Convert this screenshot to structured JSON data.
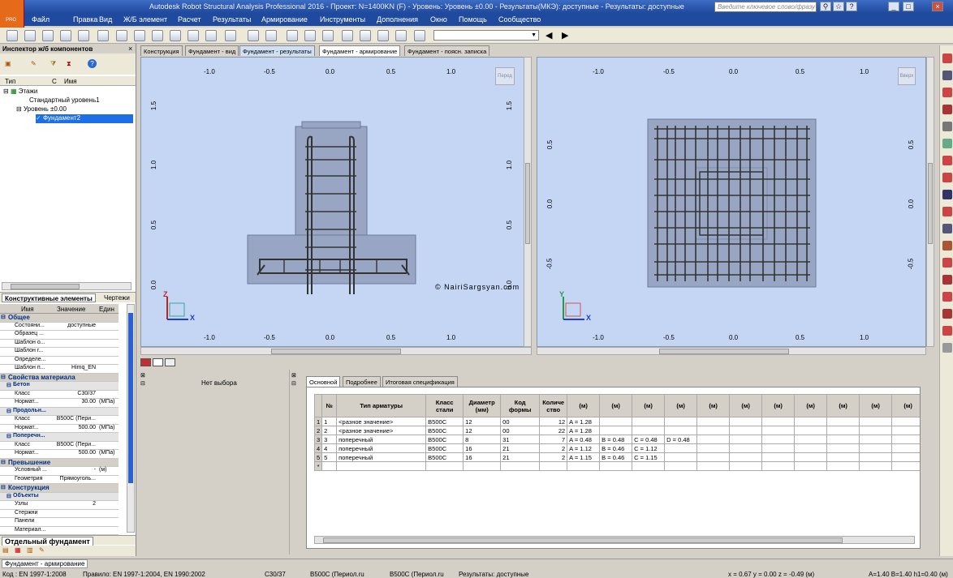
{
  "window": {
    "title": "Autodesk Robot Structural Analysis Professional 2016 - Проект: N=1400KN (F) - Уровень: Уровень ±0.00 - Результаты(МКЭ): доступные - Результаты: доступные",
    "search_placeholder": "Введите ключевое слово/фразу",
    "logo": "PRO"
  },
  "menu": [
    "Файл",
    "Правка",
    "Вид",
    "Ж/Б элемент",
    "Расчет",
    "Результаты",
    "Армирование",
    "Инструменты",
    "Дополнения",
    "Окно",
    "Помощь",
    "Сообщество"
  ],
  "inspector": {
    "title": "Инспектор ж/б компонентов",
    "col_type": "Тип",
    "col_c": "С",
    "col_name": "Имя",
    "tree": [
      "Этажи",
      "Стандартный уровень1",
      "Уровень ±0.00",
      "Фундамент2"
    ],
    "tab1": "Конструктивные элементы",
    "tab2": "Чертежи"
  },
  "props": {
    "col_name": "Имя",
    "col_value": "Значение",
    "col_unit": "Един",
    "rows": [
      {
        "type": "g",
        "n": "Общее"
      },
      {
        "n": "Состояни...",
        "v": "доступные",
        "u": ""
      },
      {
        "n": "Образец ...",
        "v": "",
        "u": ""
      },
      {
        "n": "Шаблон о...",
        "v": "",
        "u": ""
      },
      {
        "n": "Шаблон г...",
        "v": "",
        "u": ""
      },
      {
        "n": "Определе...",
        "v": "",
        "u": ""
      },
      {
        "n": "Шаблон п...",
        "v": "Himq_EN",
        "u": ""
      },
      {
        "type": "g",
        "n": "Свойства материала"
      },
      {
        "type": "s",
        "n": "Бетон"
      },
      {
        "n": "Класс",
        "v": "C30/37",
        "u": ""
      },
      {
        "n": "Нормат...",
        "v": "30.00",
        "u": "(МПа)"
      },
      {
        "type": "s",
        "n": "Продольн..."
      },
      {
        "n": "Класс",
        "v": "B500C (Пери...",
        "u": ""
      },
      {
        "n": "Нормат...",
        "v": "500.00",
        "u": "(МПа)"
      },
      {
        "type": "s",
        "n": "Поперечн..."
      },
      {
        "n": "Класс",
        "v": "B500C (Пери...",
        "u": ""
      },
      {
        "n": "Нормат...",
        "v": "500.00",
        "u": "(МПа)"
      },
      {
        "type": "g",
        "n": "Превышение"
      },
      {
        "n": "Условный ...",
        "v": "-",
        "u": "(м)"
      },
      {
        "n": "Геометрия",
        "v": "Прямоуголь...",
        "u": ""
      },
      {
        "type": "g",
        "n": "Конструкция"
      },
      {
        "type": "s",
        "n": "Объекты"
      },
      {
        "n": "Узлы",
        "v": "2",
        "u": ""
      },
      {
        "n": "Стержни",
        "v": "",
        "u": ""
      },
      {
        "n": "Панели",
        "v": "",
        "u": ""
      },
      {
        "n": "Материал...",
        "v": "",
        "u": ""
      }
    ],
    "footer_tab": "Отдельный фундамент"
  },
  "view_tabs": [
    "Конструкция",
    "Фундамент - вид",
    "Фундамент - результаты",
    "Фундамент - армирование",
    "Фундамент - поясн. записка"
  ],
  "views": {
    "left_btn": "Перед",
    "right_btn": "Вверх",
    "xticks": [
      "-1.0",
      "-0.5",
      "0.0",
      "0.5",
      "1.0"
    ],
    "left_yticks": [
      "1.5",
      "1.0",
      "0.5",
      "0.0"
    ],
    "right_yticks": [
      "0.5",
      "0.0",
      "-0.5"
    ],
    "watermark": "© NairiSargsyan.com",
    "axis_x": "X",
    "axis_z": "Z",
    "axis_y": "Y"
  },
  "bottom": {
    "no_selection": "Нет выбора",
    "tabs": [
      "Основной",
      "Подробнее",
      "Итоговая спецификация"
    ],
    "headers": [
      "№",
      "Тип арматуры",
      "Класс стали",
      "Диаметр (мм)",
      "Код формы",
      "Количе ство",
      "(м)",
      "(м)",
      "(м)",
      "(м)",
      "(м)",
      "(м)",
      "(м)",
      "(м)",
      "(м)",
      "(м)",
      "(м)"
    ],
    "rows": [
      [
        "1",
        "1",
        "<разное значение>",
        "B500C",
        "12",
        "00",
        "12",
        "A = 1.28",
        "",
        "",
        ""
      ],
      [
        "2",
        "2",
        "<разное значение>",
        "B500C",
        "12",
        "00",
        "22",
        "A = 1.28",
        "",
        "",
        ""
      ],
      [
        "3",
        "3",
        "поперечный",
        "B500C",
        "8",
        "31",
        "7",
        "A = 0.48",
        "B = 0.48",
        "C = 0.48",
        "D = 0.48"
      ],
      [
        "4",
        "4",
        "поперечный",
        "B500C",
        "16",
        "21",
        "2",
        "A = 1.12",
        "B = 0.46",
        "C = 1.12",
        ""
      ],
      [
        "5",
        "5",
        "поперечный",
        "B500C",
        "16",
        "21",
        "2",
        "A = 1.15",
        "B = 0.46",
        "C = 1.15",
        ""
      ],
      [
        "*",
        "",
        "",
        "",
        "",
        "",
        "",
        "",
        "",
        "",
        ""
      ]
    ]
  },
  "status": {
    "bottom_tab": "Фундамент - армирование",
    "code": "Код : EN 1997-1:2008",
    "rules": "Правило: EN 1997-1:2004, EN 1990:2002",
    "concrete": "C30/37",
    "steel1": "B500C (Периол.ru",
    "steel2": "B500C (Периол.ru",
    "results": "Результаты: доступные",
    "coords": "x = 0.67  y = 0.00  z = -0.49   (м)",
    "dims": "A=1.40 B=1.40 h1=0.40 (м)"
  },
  "colors": {
    "view_bg": "#c5d6f5",
    "title_bg": "#1f4a9e",
    "footing": "#98a6c4"
  }
}
